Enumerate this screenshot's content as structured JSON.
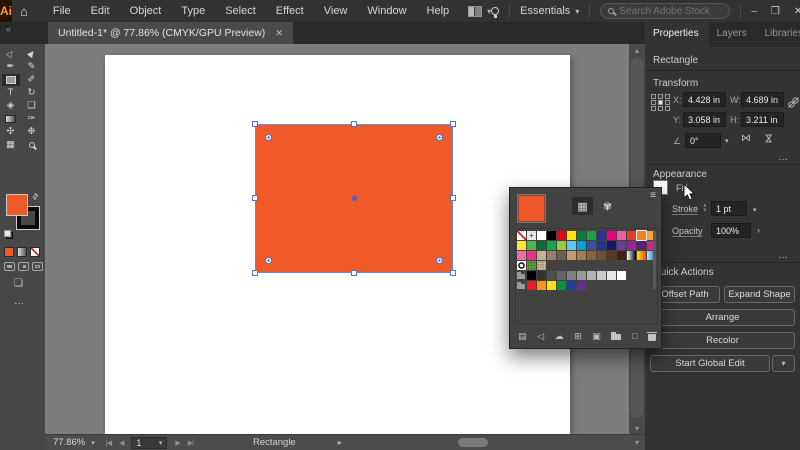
{
  "icons": {
    "home": "⌂",
    "dropdown": "▾",
    "minimize": "–",
    "restore": "❐",
    "close": "✕",
    "tab_close": "✕",
    "collapse_left": "«",
    "collapse_right": "»",
    "scroll_up": "▴",
    "scroll_down": "▾",
    "first": "|◀",
    "prev": "◀",
    "next": "▶",
    "last": "▶|",
    "menu_arrow": "▸",
    "angle": "∠",
    "flip_h": "⋈",
    "flip_v": "⋈",
    "step_up": "∧",
    "step_down": "∨",
    "opacity_more": "›",
    "more": "…",
    "hamburger": "≡",
    "screen_mode": "❏",
    "swatches_view": "▦",
    "color_mixer_view": "✾"
  },
  "colors": {
    "accent_orange": "#F05A28",
    "selection_blue": "#4F74D8"
  },
  "menubar": {
    "logo": "Ai",
    "menus": [
      "File",
      "Edit",
      "Object",
      "Type",
      "Select",
      "Effect",
      "View",
      "Window",
      "Help"
    ],
    "workspace": "Essentials",
    "search_placeholder": "Search Adobe Stock"
  },
  "tab_bar": {
    "document_title": "Untitled-1* @ 77.86% (CMYK/GPU Preview)"
  },
  "toolbar": {
    "tools": [
      {
        "name": "selection-tool",
        "glyph": "▷",
        "rot": true
      },
      {
        "name": "direct-selection-tool",
        "glyph": "▶",
        "rot": true
      },
      {
        "name": "pen-tool",
        "glyph": "✒"
      },
      {
        "name": "curvature-tool",
        "glyph": "✎"
      },
      {
        "name": "rectangle-tool",
        "glyph": "rect",
        "selected": true
      },
      {
        "name": "paintbrush-tool",
        "glyph": "✐"
      },
      {
        "name": "type-tool",
        "glyph": "T"
      },
      {
        "name": "rotate-tool",
        "glyph": "↻"
      },
      {
        "name": "eraser-tool",
        "glyph": "◈"
      },
      {
        "name": "shape-builder-tool",
        "glyph": "❏"
      },
      {
        "name": "gradient-tool",
        "glyph": "grad"
      },
      {
        "name": "eyedropper-tool",
        "glyph": "✑"
      },
      {
        "name": "blend-tool",
        "glyph": "✣"
      },
      {
        "name": "symbol-sprayer-tool",
        "glyph": "❉"
      },
      {
        "name": "artboard-tool",
        "glyph": "▦"
      },
      {
        "name": "zoom-tool",
        "glyph": "mag"
      }
    ]
  },
  "right_panel": {
    "tabs": [
      "Properties",
      "Layers",
      "Libraries"
    ],
    "active_tab": "Properties",
    "object_type": "Rectangle",
    "transform": {
      "heading": "Transform",
      "x_label": "X:",
      "x_value": "4.428 in",
      "y_label": "Y:",
      "y_value": "3.058 in",
      "w_label": "W:",
      "w_value": "4.689 in",
      "h_label": "H:",
      "h_value": "3.211 in",
      "rotate_value": "0°"
    },
    "appearance": {
      "heading": "Appearance",
      "fill_label": "Fill",
      "stroke_label": "Stroke",
      "stroke_value": "1 pt",
      "opacity_label": "Opacity",
      "opacity_value": "100%"
    },
    "quick_actions": {
      "heading": "Quick Actions",
      "buttons": [
        "Offset Path",
        "Expand Shape",
        "Arrange",
        "Recolor",
        "Start Global Edit"
      ]
    }
  },
  "swatches_panel": {
    "selected_color": "#F0582B",
    "rows": [
      [
        "none",
        "reg",
        "#FFFFFF",
        "#000000",
        "#E30613",
        "#FFE600",
        "#0D7A3C",
        "#1FA24A",
        "#2E3192",
        "#E6007E",
        "#EC619F",
        "#E63B23",
        "sel:#F0831E",
        "#F9A13A"
      ],
      [
        "#FFE92C",
        "#4CB748",
        "#0E6B37",
        "#19A54E",
        "#9BCB3C",
        "#5FC8EE",
        "#009FDA",
        "#3953A4",
        "#27348B",
        "#1B1464",
        "#6A3B96",
        "#92278F",
        "#52257B",
        "#C42A87"
      ],
      [
        "#ED6EA7",
        "#E5338D",
        "#C7B299",
        "#94826E",
        "#6E5F51",
        "#C69C6D",
        "#A67C52",
        "#8C6239",
        "#73512F",
        "#5B3A1A",
        "#3F2212",
        "grad:#FFFFFF,#000000",
        "grad:#FFE600,#E8491F",
        "grad:#BFE3F5,#1B75BB"
      ],
      [
        "patdot",
        "patleaf",
        "pattex"
      ],
      [
        "folder",
        "#000000",
        "#333333",
        "#4D4D4D",
        "#666666",
        "#808080",
        "#999999",
        "#B3B3B3",
        "#CCCCCC",
        "#E6E6E6",
        "#FFFFFF"
      ],
      [
        "folder",
        "#ED1C24",
        "#F7941E",
        "#FFDE17",
        "#009444",
        "#21409A",
        "#662D91"
      ]
    ],
    "footer_icons": [
      {
        "name": "swatch-libraries-menu",
        "glyph": "▤"
      },
      {
        "name": "show-swatch-kinds-menu",
        "glyph": "◁"
      },
      {
        "name": "add-to-library",
        "glyph": "☁"
      },
      {
        "name": "new-color-group",
        "glyph": "⊞"
      },
      {
        "name": "swatch-options",
        "glyph": "▣"
      },
      {
        "name": "new-folder",
        "glyph": "folder"
      },
      {
        "name": "new-swatch",
        "glyph": "□"
      },
      {
        "name": "delete-swatch",
        "glyph": "trash"
      }
    ]
  },
  "status_bar": {
    "zoom_level": "77.86%",
    "artboard_number": "1",
    "active_label": "Rectangle"
  }
}
